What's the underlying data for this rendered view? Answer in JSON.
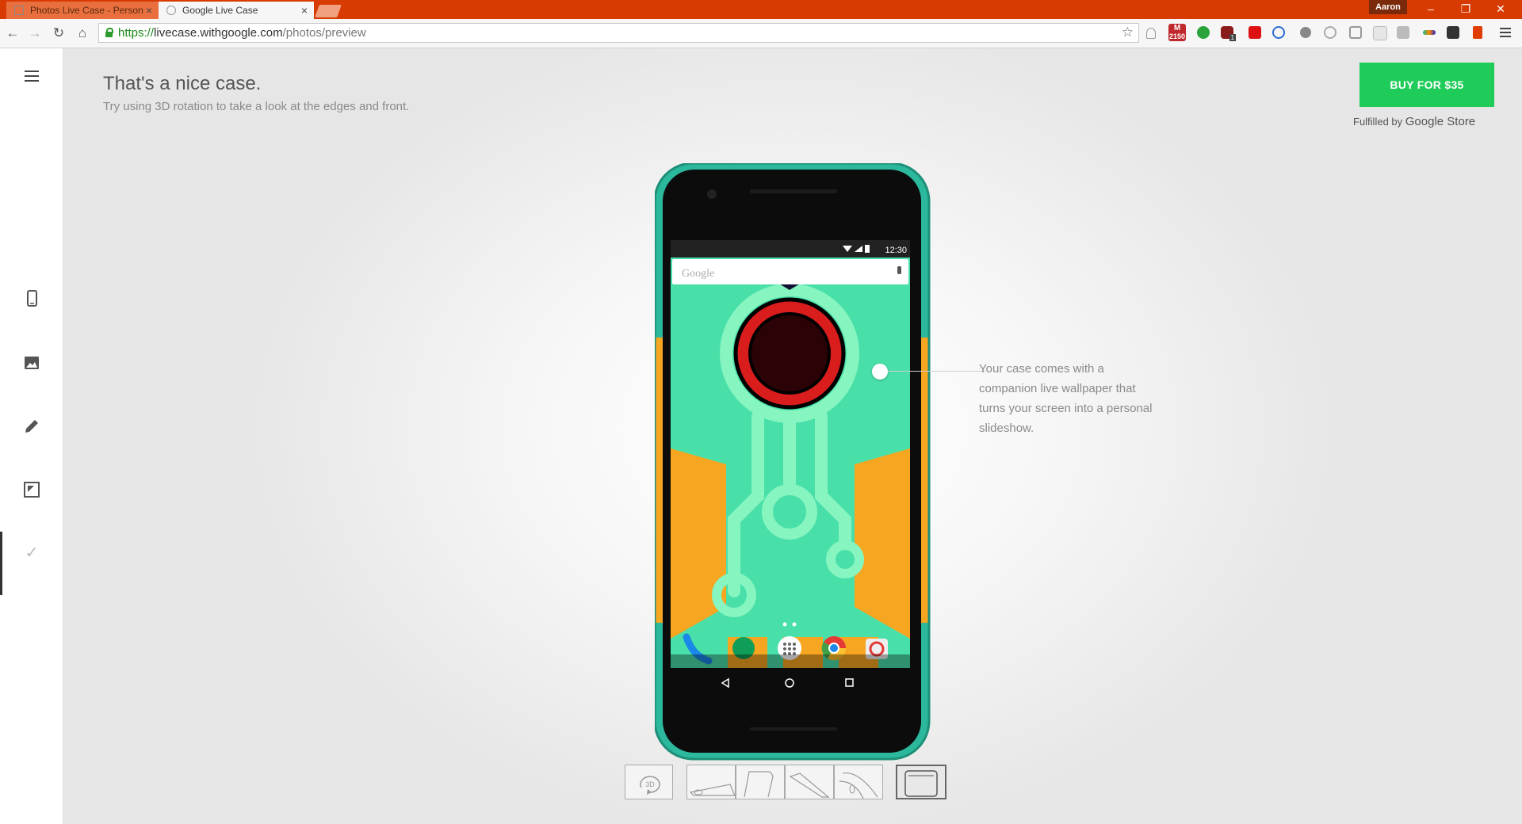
{
  "browser": {
    "tabs": [
      {
        "title": "Photos Live Case - Person",
        "active": false
      },
      {
        "title": "Google Live Case",
        "active": true
      }
    ],
    "profile_name": "Aaron",
    "url": {
      "protocol": "https://",
      "host": "livecase.withgoogle.com",
      "path": "/photos/preview"
    },
    "gmail_badge": "2150",
    "ext_badge_1": "1"
  },
  "header": {
    "title": "That's a nice case.",
    "subtitle": "Try using 3D rotation to take a look at the edges and front."
  },
  "purchase": {
    "buy_label": "BUY FOR  $35",
    "fulfilled_prefix": "Fulfilled by",
    "fulfilled_brand": "Google Store"
  },
  "phone_screen": {
    "time": "12:30",
    "search_placeholder": "Google"
  },
  "callout": {
    "text": "Your case comes with a companion live wallpaper that turns your screen into a personal slideshow."
  },
  "views": {
    "rotate_label": "3D",
    "selected_index": 3
  },
  "colors": {
    "accent_buy": "#1fcc5a",
    "titlebar": "#d83b01",
    "case_teal": "#2bb89c",
    "case_orange": "#f7a621",
    "wallpaper_mint": "#49dfa9",
    "circle_red": "#d91c1c"
  },
  "icons": {
    "rail": [
      "menu-icon",
      "phone-icon",
      "image-icon",
      "pencil-icon",
      "frame-icon",
      "check-icon"
    ]
  }
}
